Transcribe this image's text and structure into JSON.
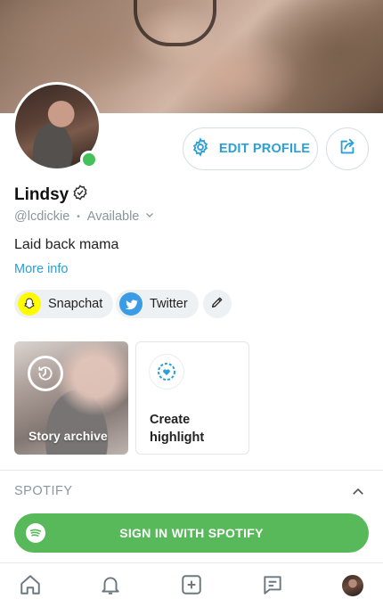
{
  "profile": {
    "name": "Lindsy",
    "handle": "@lcdickie",
    "separator": "•",
    "availability": "Available",
    "bio": "Laid back mama",
    "more_info": "More info"
  },
  "actions": {
    "edit_profile": "EDIT PROFILE"
  },
  "social": {
    "snapchat": "Snapchat",
    "twitter": "Twitter"
  },
  "stories": {
    "archive_label": "Story archive",
    "create_highlight_label": "Create highlight"
  },
  "spotify": {
    "section_title": "SPOTIFY",
    "sign_in_label": "SIGN IN WITH SPOTIFY"
  },
  "colors": {
    "accent": "#2b9fd8",
    "online": "#44c15a",
    "spotify_green": "#58b95a",
    "snapchat_yellow": "#fffc00",
    "twitter_blue": "#3a9be6"
  },
  "icons": [
    "gear-icon",
    "share-icon",
    "verified-icon",
    "chevron-down-icon",
    "snapchat-icon",
    "twitter-icon",
    "pencil-icon",
    "clock-icon",
    "heart-icon",
    "chevron-up-icon",
    "spotify-icon",
    "home-icon",
    "bell-icon",
    "plus-icon",
    "chat-icon"
  ]
}
